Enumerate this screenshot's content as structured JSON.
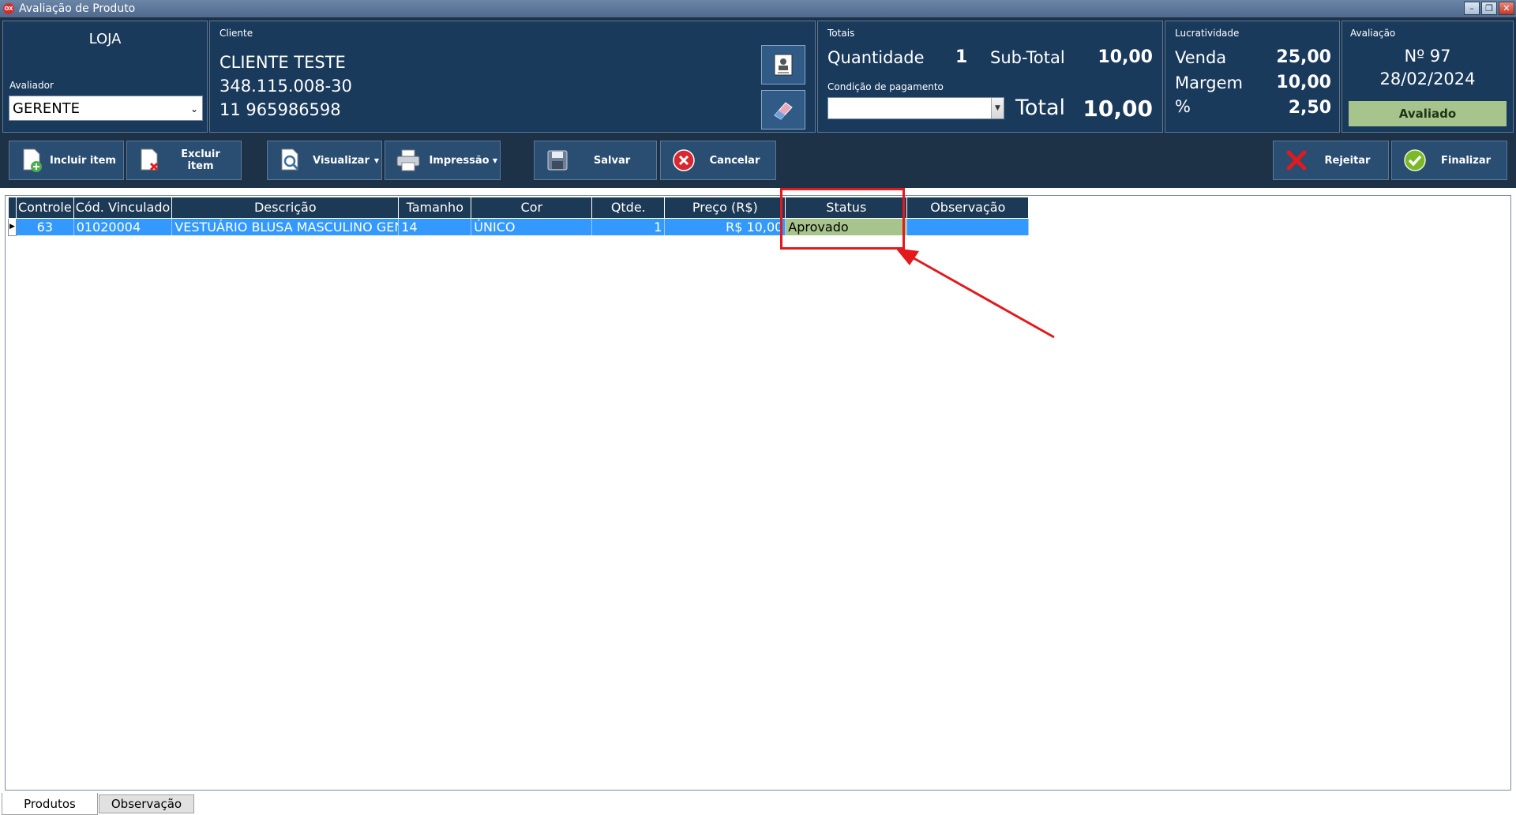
{
  "window": {
    "title": "Avaliação de Produto",
    "app_badge": "OX"
  },
  "loja": {
    "title": "LOJA",
    "avaliador_label": "Avaliador",
    "avaliador_value": "GERENTE"
  },
  "cliente": {
    "label": "Cliente",
    "name": "CLIENTE TESTE",
    "document": "348.115.008-30",
    "phone": "11 965986598"
  },
  "totais": {
    "label": "Totais",
    "quantidade_label": "Quantidade",
    "quantidade_value": "1",
    "subtotal_label": "Sub-Total",
    "subtotal_value": "10,00",
    "condicao_label": "Condição de pagamento",
    "condicao_value": "",
    "total_label": "Total",
    "total_value": "10,00"
  },
  "lucratividade": {
    "label": "Lucratividade",
    "venda_label": "Venda",
    "venda_value": "25,00",
    "margem_label": "Margem",
    "margem_value": "10,00",
    "percent_label": "%",
    "percent_value": "2,50"
  },
  "avaliacao": {
    "label": "Avaliação",
    "numero": "Nº 97",
    "data": "28/02/2024",
    "status": "Avaliado"
  },
  "toolbar": {
    "incluir": "Incluir item",
    "excluir": "Excluir item",
    "visualizar": "Visualizar",
    "impressao": "Impressão",
    "salvar": "Salvar",
    "cancelar": "Cancelar",
    "rejeitar": "Rejeitar",
    "finalizar": "Finalizar"
  },
  "grid": {
    "columns": [
      "Controle",
      "Cód. Vinculado",
      "Descrição",
      "Tamanho",
      "Cor",
      "Qtde.",
      "Preço (R$)",
      "Status",
      "Observação"
    ],
    "rows": [
      {
        "controle": "63",
        "cod": "01020004",
        "descricao": "VESTUÁRIO BLUSA MASCULINO GENE",
        "tamanho": "14",
        "cor": "ÚNICO",
        "qtde": "1",
        "preco": "R$ 10,00",
        "status": "Aprovado",
        "obs": ""
      }
    ]
  },
  "tabs": [
    "Produtos",
    "Observação"
  ],
  "colors": {
    "panel": "#1a3a5c",
    "selection": "#3399ff",
    "approved": "#a6c48c",
    "annotation": "#e3191c"
  }
}
